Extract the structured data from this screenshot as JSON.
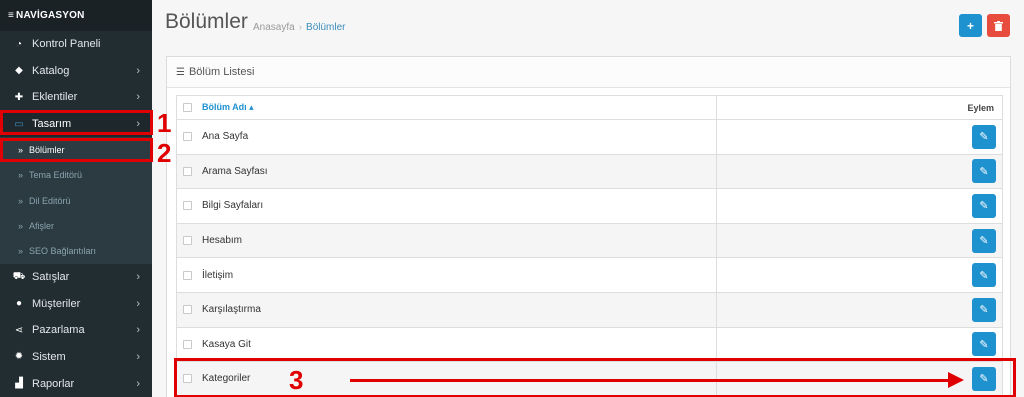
{
  "sidebar": {
    "header": "NAVİGASYON",
    "items": [
      {
        "label": "Kontrol Paneli",
        "icon": "dashboard-icon",
        "has_chevron": false
      },
      {
        "label": "Katalog",
        "icon": "tags-icon",
        "has_chevron": true
      },
      {
        "label": "Eklentiler",
        "icon": "puzzle-icon",
        "has_chevron": true
      },
      {
        "label": "Tasarım",
        "icon": "monitor-icon",
        "has_chevron": true,
        "active": true
      },
      {
        "label": "Satışlar",
        "icon": "cart-icon",
        "has_chevron": true
      },
      {
        "label": "Müşteriler",
        "icon": "user-icon",
        "has_chevron": true
      },
      {
        "label": "Pazarlama",
        "icon": "share-icon",
        "has_chevron": true
      },
      {
        "label": "Sistem",
        "icon": "gear-icon",
        "has_chevron": true
      },
      {
        "label": "Raporlar",
        "icon": "bar-chart-icon",
        "has_chevron": true
      }
    ],
    "submenu": [
      {
        "label": "Bölümler",
        "current": true
      },
      {
        "label": "Tema Editörü"
      },
      {
        "label": "Dil Editörü"
      },
      {
        "label": "Afişler"
      },
      {
        "label": "SEO Bağlantıları"
      }
    ]
  },
  "header": {
    "title": "Bölümler",
    "breadcrumb": [
      "Anasayfa",
      "Bölümler"
    ],
    "add_button": "+",
    "delete_button": "🗑"
  },
  "panel": {
    "title": "Bölüm Listesi",
    "columns": [
      "Bölüm Adı ▴",
      "Eylem"
    ],
    "rows": [
      "Ana Sayfa",
      "Arama Sayfası",
      "Bilgi Sayfaları",
      "Hesabım",
      "İletişim",
      "Karşılaştırma",
      "Kasaya Git",
      "Kategoriler"
    ]
  },
  "annotations": {
    "labels": [
      "1",
      "2",
      "3"
    ],
    "color": "#e00000"
  },
  "colors": {
    "sidebar_bg": "#222d32",
    "primary": "#1e91cf",
    "danger": "#e74c3c"
  }
}
